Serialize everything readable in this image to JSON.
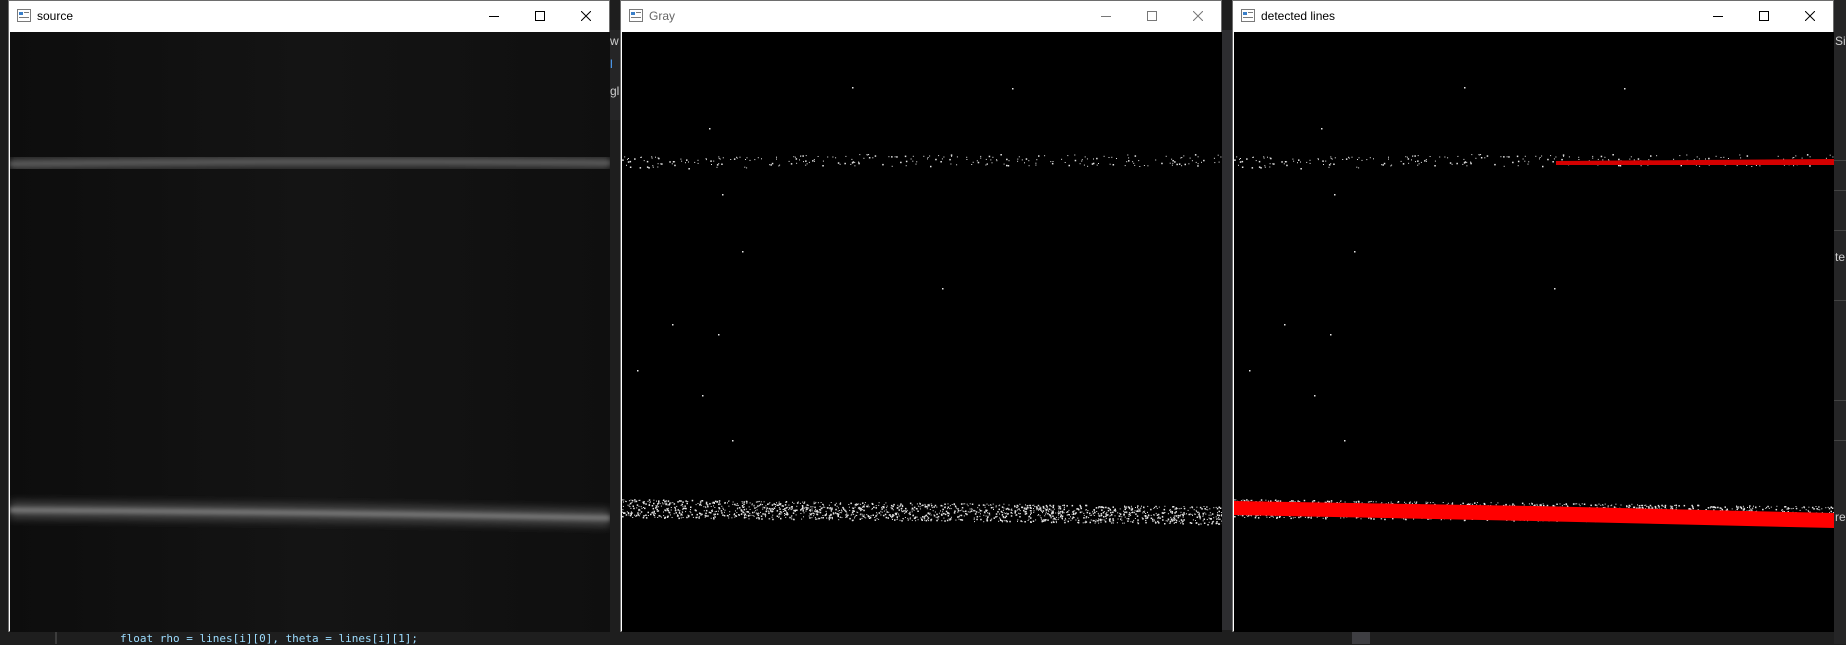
{
  "windows": {
    "source": {
      "title": "source"
    },
    "gray": {
      "title": "Gray"
    },
    "detected": {
      "title": "detected lines"
    }
  },
  "caption_buttons": {
    "minimize": "minimize-icon",
    "maximize": "maximize-icon",
    "close": "close-icon"
  },
  "background": {
    "code_line": "float rho = lines[i][0], theta = lines[i][1];",
    "left_strip": [
      "w",
      "l",
      "gl"
    ],
    "right_strip": [
      "Si",
      "te",
      "re"
    ]
  },
  "colors": {
    "line_overlay": "#ff0000",
    "window_frame": "#ffffff",
    "canvas": "#000000"
  }
}
